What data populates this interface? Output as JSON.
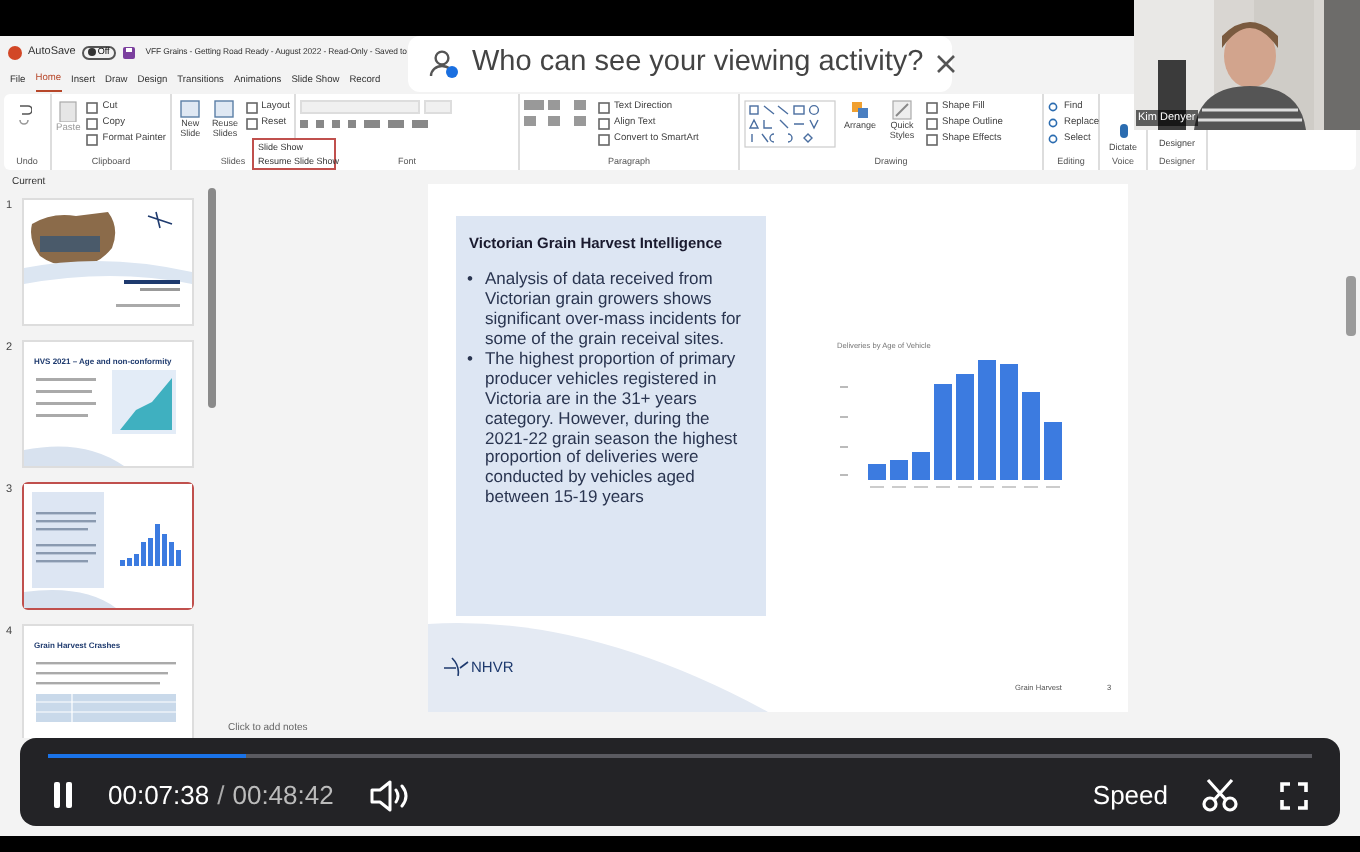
{
  "title_bar": {
    "autosave_label": "AutoSave",
    "autosave_state": "Off",
    "document_title": "VFF Grains - Getting Road Ready - August 2022 - Read-Only - Saved to"
  },
  "ribbon_tabs": [
    {
      "label": "File",
      "selected": false
    },
    {
      "label": "Home",
      "selected": true
    },
    {
      "label": "Insert",
      "selected": false
    },
    {
      "label": "Draw",
      "selected": false
    },
    {
      "label": "Design",
      "selected": false
    },
    {
      "label": "Transitions",
      "selected": false
    },
    {
      "label": "Animations",
      "selected": false
    },
    {
      "label": "Slide Show",
      "selected": false
    },
    {
      "label": "Record",
      "selected": false
    }
  ],
  "ribbon_groups": [
    {
      "kind": "undo",
      "label": "Undo"
    },
    {
      "kind": "clipboard",
      "label": "Clipboard",
      "commands": [
        "Paste",
        "Cut",
        "Copy",
        "Format Painter"
      ]
    },
    {
      "kind": "slides",
      "label": "Slides",
      "commands": [
        "New Slide",
        "Reuse Slides",
        "Layout",
        "Reset"
      ]
    },
    {
      "kind": "font",
      "label": "Font"
    },
    {
      "kind": "paragraph",
      "label": "Paragraph",
      "commands": [
        "Text Direction",
        "Align Text",
        "Convert to SmartArt"
      ]
    },
    {
      "kind": "drawing",
      "label": "Drawing",
      "commands": [
        "Arrange",
        "Quick Styles",
        "Shape Fill",
        "Shape Outline",
        "Shape Effects"
      ]
    },
    {
      "kind": "editing",
      "label": "Editing",
      "commands": [
        "Find",
        "Replace",
        "Select"
      ]
    },
    {
      "kind": "voice",
      "label": "Voice",
      "commands": [
        "Dictate"
      ]
    },
    {
      "kind": "designer",
      "label": "Designer",
      "commands": [
        "Designer"
      ]
    }
  ],
  "slideshow_popup": {
    "items": [
      "Slide Show",
      "Resume Slide Show"
    ]
  },
  "privacy_banner": {
    "text": "Who can see your viewing activity?"
  },
  "webcam": {
    "name": "Kim Denyer"
  },
  "slide_pane": {
    "section": "Current",
    "slides": [
      {
        "number": "1",
        "kind": "cover",
        "selected": false
      },
      {
        "number": "2",
        "kind": "chart",
        "title": "HVS 2021 – Age and non-conformity",
        "selected": false
      },
      {
        "number": "3",
        "kind": "bars",
        "selected": true
      },
      {
        "number": "4",
        "kind": "table",
        "title": "Grain Harvest Crashes",
        "selected": false
      }
    ]
  },
  "slide": {
    "title": "Victorian Grain Harvest Intelligence",
    "bullets": [
      {
        "marker": "•",
        "text": "Analysis of data received from Victorian grain growers shows significant over-mass incidents for some of the grain receival sites."
      },
      {
        "marker": "•",
        "text": "The highest proportion of primary producer vehicles registered in Victoria are in the 31+ years category. However, during the 2021-22 grain season the highest proportion of deliveries were conducted by vehicles aged between 15-19 years"
      }
    ],
    "chart_title": "Deliveries by Age of Vehicle",
    "logo_text": "NHVR",
    "footer": "Grain Harvest",
    "page_number": "3"
  },
  "notes": {
    "placeholder": "Click to add notes"
  },
  "player": {
    "playing": true,
    "level": 0.157,
    "elapsed": "00:07:38",
    "separator": "/",
    "duration": "00:48:42",
    "speed_label": "Speed"
  }
}
